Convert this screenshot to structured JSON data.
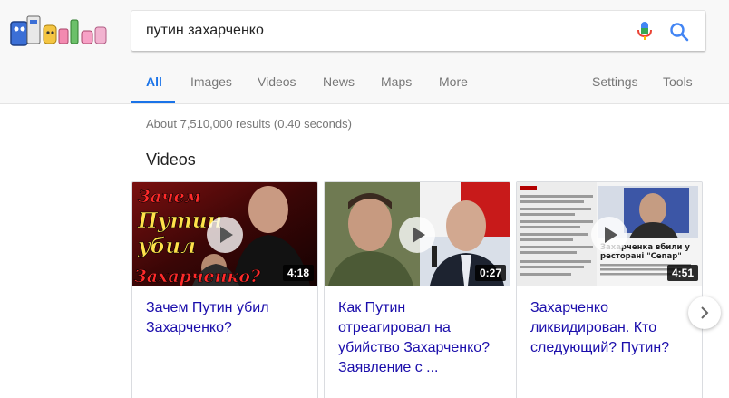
{
  "search": {
    "query": "путин захарченко"
  },
  "tabs": [
    {
      "label": "All",
      "active": true
    },
    {
      "label": "Images"
    },
    {
      "label": "Videos"
    },
    {
      "label": "News"
    },
    {
      "label": "Maps"
    },
    {
      "label": "More"
    }
  ],
  "tools": {
    "settings": "Settings",
    "tools": "Tools"
  },
  "results": {
    "stats": "About 7,510,000 results (0.40 seconds)"
  },
  "videos": {
    "heading": "Videos",
    "items": [
      {
        "title": "Зачем Путин убил Захарченко?",
        "duration": "4:18",
        "overlay_text": "Зачем Путин убил Захарченко?"
      },
      {
        "title": "Как Путин отреагировал на убийство Захарченко? Заявление с ...",
        "duration": "0:27"
      },
      {
        "title": "Захарченко ликвидирован. Кто следующий? Путин?",
        "duration": "4:51",
        "overlay_caption": "Захарченка вбили у ресторані \"Сепар\""
      }
    ]
  },
  "colors": {
    "link": "#1a0dab",
    "accent": "#1a73e8",
    "muted": "#777777"
  },
  "icons": {
    "mic": "microphone-icon",
    "search": "magnifier-icon",
    "next": "chevron-right-icon"
  }
}
